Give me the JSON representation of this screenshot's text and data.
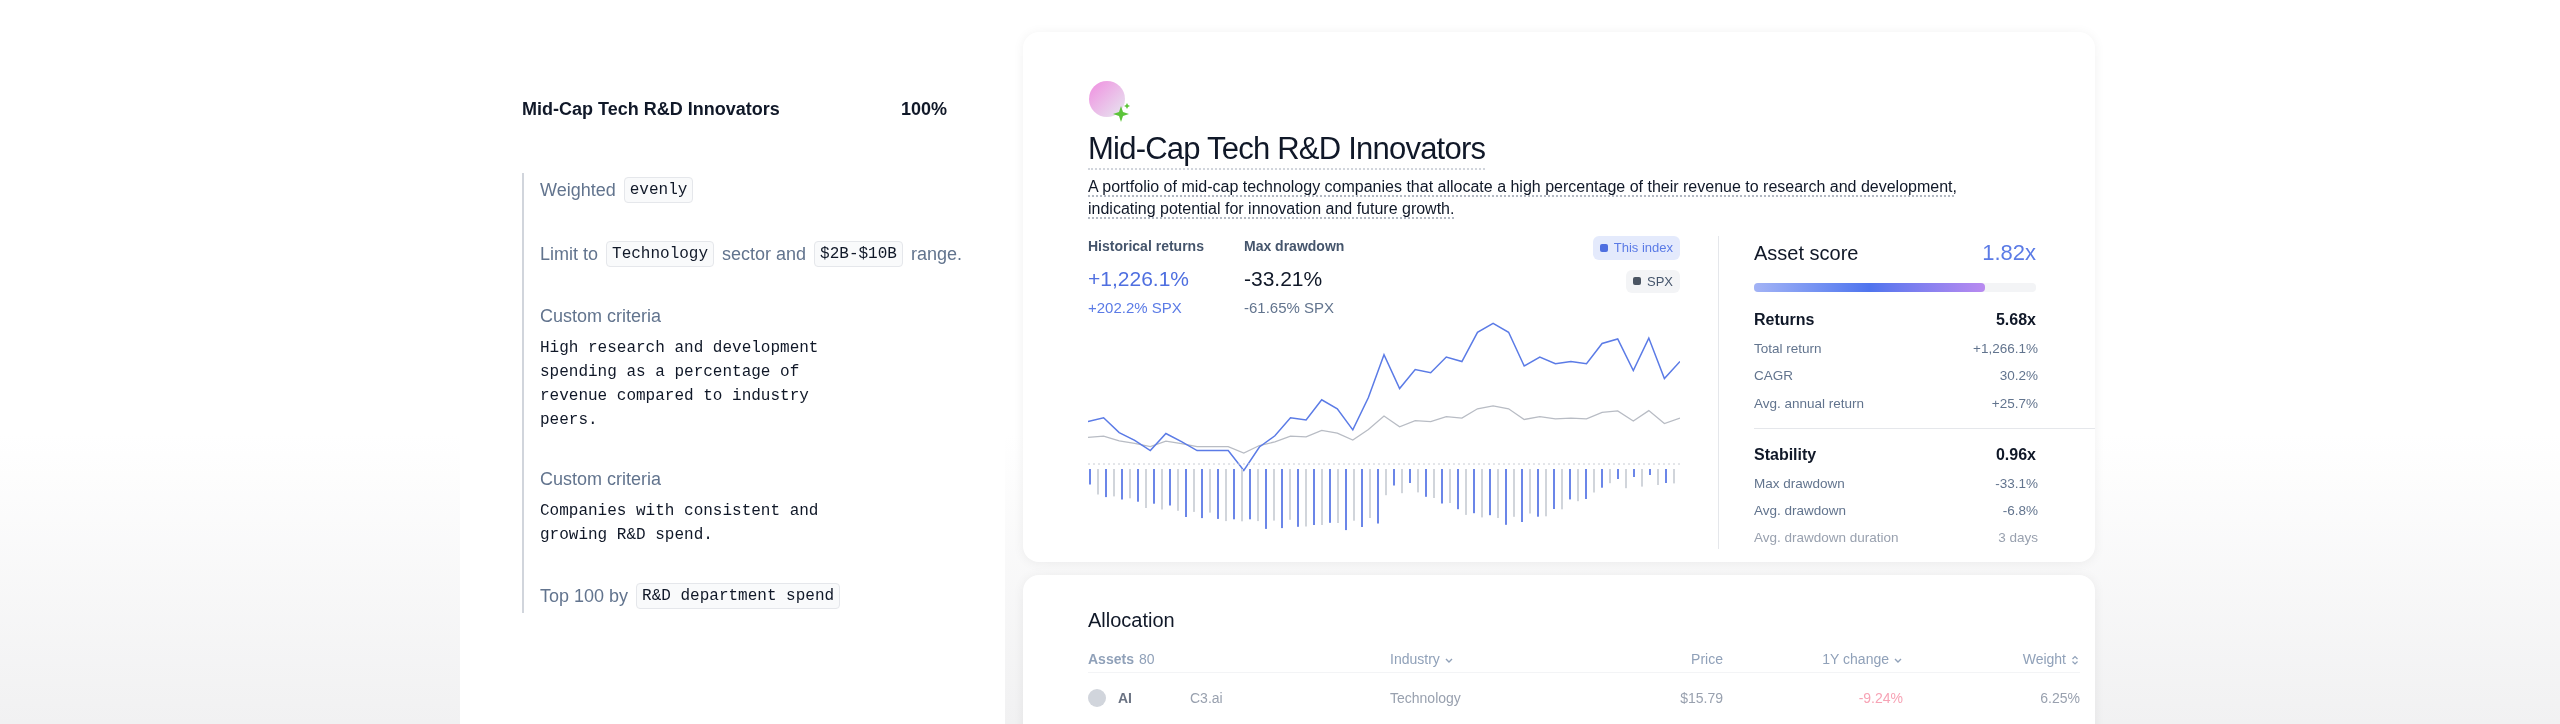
{
  "criteria_panel": {
    "title": "Mid-Cap Tech R&D Innovators",
    "weight": "100%",
    "items": [
      {
        "kind": "sentence",
        "parts": [
          {
            "text": "Weighted",
            "code": false
          },
          {
            "text": "evenly",
            "code": true
          }
        ]
      },
      {
        "kind": "sentence",
        "parts": [
          {
            "text": "Limit to",
            "code": false
          },
          {
            "text": "Technology",
            "code": true
          },
          {
            "text": "sector and",
            "code": false
          },
          {
            "text": "$2B-$10B",
            "code": true
          },
          {
            "text": "range.",
            "code": false
          }
        ]
      },
      {
        "kind": "custom",
        "label": "Custom criteria",
        "text": "High research and development spending as a percentage of revenue compared to industry peers."
      },
      {
        "kind": "custom",
        "label": "Custom criteria",
        "text": "Companies with consistent and growing R&D spend."
      },
      {
        "kind": "sentence",
        "parts": [
          {
            "text": "Top 100 by",
            "code": false
          },
          {
            "text": "R&D department spend",
            "code": true
          }
        ]
      }
    ]
  },
  "index_card": {
    "title": "Mid-Cap Tech R&D Innovators",
    "description": "A portfolio of mid-cap technology companies that allocate a high percentage of their revenue to research and development, indicating potential for innovation and future growth.",
    "stats": [
      {
        "label": "Historical returns",
        "value": "+1,226.1%",
        "benchmark": "+202.2% SPX",
        "kind": "returns"
      },
      {
        "label": "Max drawdown",
        "value": "-33.21%",
        "benchmark": "-61.65% SPX",
        "kind": "drawdown"
      }
    ],
    "legend": [
      {
        "label": "This index",
        "color": "#4f6fe0",
        "selected": true
      },
      {
        "label": "SPX",
        "color": "#4b5563",
        "selected": false
      }
    ],
    "asset_score": {
      "label": "Asset score",
      "value": "1.82x",
      "level": 0.82
    },
    "groups": [
      {
        "name": "Returns",
        "score": "5.68x",
        "rows": [
          {
            "label": "Total return",
            "value": "+1,266.1%",
            "faded": false
          },
          {
            "label": "CAGR",
            "value": "30.2%",
            "faded": false
          },
          {
            "label": "Avg. annual return",
            "value": "+25.7%",
            "faded": false
          }
        ]
      },
      {
        "name": "Stability",
        "score": "0.96x",
        "rows": [
          {
            "label": "Max drawdown",
            "value": "-33.1%",
            "faded": false
          },
          {
            "label": "Avg. drawdown",
            "value": "-6.8%",
            "faded": false
          },
          {
            "label": "Avg. drawdown duration",
            "value": "3 days",
            "faded": true
          }
        ]
      }
    ]
  },
  "allocation": {
    "title": "Allocation",
    "assets_label": "Assets",
    "assets_count": "80",
    "columns": [
      {
        "label": "Industry",
        "kind": "dropdown"
      },
      {
        "label": "Price",
        "kind": "plain"
      },
      {
        "label": "1Y change",
        "kind": "dropdown"
      },
      {
        "label": "Weight",
        "kind": "sortable"
      }
    ],
    "rows": [
      {
        "ticker": "AI",
        "name": "C3.ai",
        "industry": "Technology",
        "price": "$15.79",
        "change": "-9.24%",
        "weight": "6.25%"
      }
    ]
  }
}
